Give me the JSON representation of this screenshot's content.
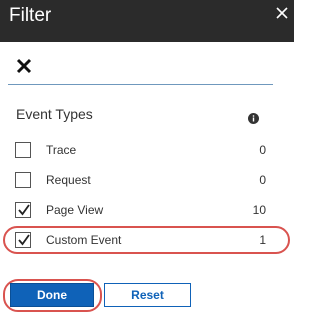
{
  "header": {
    "title": "Filter",
    "close_icon": "close-icon"
  },
  "filter": {
    "clear_icon": "x-icon"
  },
  "event_types": {
    "title": "Event Types",
    "info_icon": "info-icon",
    "items": [
      {
        "label": "Trace",
        "count": "0",
        "checked": false
      },
      {
        "label": "Request",
        "count": "0",
        "checked": false
      },
      {
        "label": "Page View",
        "count": "10",
        "checked": true
      },
      {
        "label": "Custom Event",
        "count": "1",
        "checked": true
      }
    ]
  },
  "buttons": {
    "done": "Done",
    "reset": "Reset"
  },
  "colors": {
    "header_bg": "#2b2b2b",
    "accent": "#0f62b8",
    "highlight": "#d9534f"
  }
}
